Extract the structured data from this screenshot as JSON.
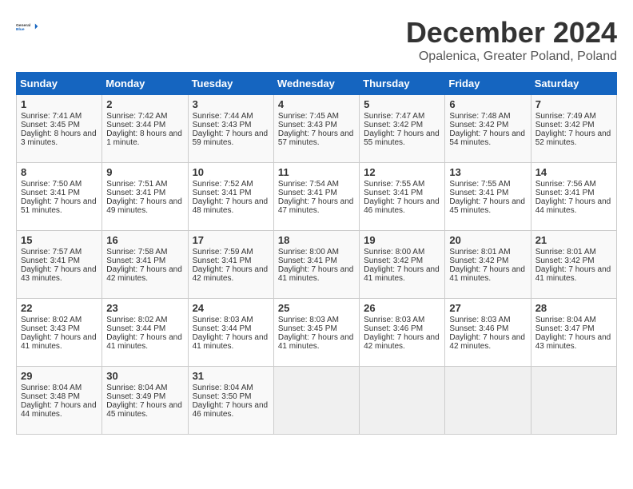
{
  "header": {
    "logo_line1": "General",
    "logo_line2": "Blue",
    "month_title": "December 2024",
    "subtitle": "Opalenica, Greater Poland, Poland"
  },
  "days_of_week": [
    "Sunday",
    "Monday",
    "Tuesday",
    "Wednesday",
    "Thursday",
    "Friday",
    "Saturday"
  ],
  "weeks": [
    [
      {
        "day": "1",
        "sunrise": "Sunrise: 7:41 AM",
        "sunset": "Sunset: 3:45 PM",
        "daylight": "Daylight: 8 hours and 3 minutes."
      },
      {
        "day": "2",
        "sunrise": "Sunrise: 7:42 AM",
        "sunset": "Sunset: 3:44 PM",
        "daylight": "Daylight: 8 hours and 1 minute."
      },
      {
        "day": "3",
        "sunrise": "Sunrise: 7:44 AM",
        "sunset": "Sunset: 3:43 PM",
        "daylight": "Daylight: 7 hours and 59 minutes."
      },
      {
        "day": "4",
        "sunrise": "Sunrise: 7:45 AM",
        "sunset": "Sunset: 3:43 PM",
        "daylight": "Daylight: 7 hours and 57 minutes."
      },
      {
        "day": "5",
        "sunrise": "Sunrise: 7:47 AM",
        "sunset": "Sunset: 3:42 PM",
        "daylight": "Daylight: 7 hours and 55 minutes."
      },
      {
        "day": "6",
        "sunrise": "Sunrise: 7:48 AM",
        "sunset": "Sunset: 3:42 PM",
        "daylight": "Daylight: 7 hours and 54 minutes."
      },
      {
        "day": "7",
        "sunrise": "Sunrise: 7:49 AM",
        "sunset": "Sunset: 3:42 PM",
        "daylight": "Daylight: 7 hours and 52 minutes."
      }
    ],
    [
      {
        "day": "8",
        "sunrise": "Sunrise: 7:50 AM",
        "sunset": "Sunset: 3:41 PM",
        "daylight": "Daylight: 7 hours and 51 minutes."
      },
      {
        "day": "9",
        "sunrise": "Sunrise: 7:51 AM",
        "sunset": "Sunset: 3:41 PM",
        "daylight": "Daylight: 7 hours and 49 minutes."
      },
      {
        "day": "10",
        "sunrise": "Sunrise: 7:52 AM",
        "sunset": "Sunset: 3:41 PM",
        "daylight": "Daylight: 7 hours and 48 minutes."
      },
      {
        "day": "11",
        "sunrise": "Sunrise: 7:54 AM",
        "sunset": "Sunset: 3:41 PM",
        "daylight": "Daylight: 7 hours and 47 minutes."
      },
      {
        "day": "12",
        "sunrise": "Sunrise: 7:55 AM",
        "sunset": "Sunset: 3:41 PM",
        "daylight": "Daylight: 7 hours and 46 minutes."
      },
      {
        "day": "13",
        "sunrise": "Sunrise: 7:55 AM",
        "sunset": "Sunset: 3:41 PM",
        "daylight": "Daylight: 7 hours and 45 minutes."
      },
      {
        "day": "14",
        "sunrise": "Sunrise: 7:56 AM",
        "sunset": "Sunset: 3:41 PM",
        "daylight": "Daylight: 7 hours and 44 minutes."
      }
    ],
    [
      {
        "day": "15",
        "sunrise": "Sunrise: 7:57 AM",
        "sunset": "Sunset: 3:41 PM",
        "daylight": "Daylight: 7 hours and 43 minutes."
      },
      {
        "day": "16",
        "sunrise": "Sunrise: 7:58 AM",
        "sunset": "Sunset: 3:41 PM",
        "daylight": "Daylight: 7 hours and 42 minutes."
      },
      {
        "day": "17",
        "sunrise": "Sunrise: 7:59 AM",
        "sunset": "Sunset: 3:41 PM",
        "daylight": "Daylight: 7 hours and 42 minutes."
      },
      {
        "day": "18",
        "sunrise": "Sunrise: 8:00 AM",
        "sunset": "Sunset: 3:41 PM",
        "daylight": "Daylight: 7 hours and 41 minutes."
      },
      {
        "day": "19",
        "sunrise": "Sunrise: 8:00 AM",
        "sunset": "Sunset: 3:42 PM",
        "daylight": "Daylight: 7 hours and 41 minutes."
      },
      {
        "day": "20",
        "sunrise": "Sunrise: 8:01 AM",
        "sunset": "Sunset: 3:42 PM",
        "daylight": "Daylight: 7 hours and 41 minutes."
      },
      {
        "day": "21",
        "sunrise": "Sunrise: 8:01 AM",
        "sunset": "Sunset: 3:42 PM",
        "daylight": "Daylight: 7 hours and 41 minutes."
      }
    ],
    [
      {
        "day": "22",
        "sunrise": "Sunrise: 8:02 AM",
        "sunset": "Sunset: 3:43 PM",
        "daylight": "Daylight: 7 hours and 41 minutes."
      },
      {
        "day": "23",
        "sunrise": "Sunrise: 8:02 AM",
        "sunset": "Sunset: 3:44 PM",
        "daylight": "Daylight: 7 hours and 41 minutes."
      },
      {
        "day": "24",
        "sunrise": "Sunrise: 8:03 AM",
        "sunset": "Sunset: 3:44 PM",
        "daylight": "Daylight: 7 hours and 41 minutes."
      },
      {
        "day": "25",
        "sunrise": "Sunrise: 8:03 AM",
        "sunset": "Sunset: 3:45 PM",
        "daylight": "Daylight: 7 hours and 41 minutes."
      },
      {
        "day": "26",
        "sunrise": "Sunrise: 8:03 AM",
        "sunset": "Sunset: 3:46 PM",
        "daylight": "Daylight: 7 hours and 42 minutes."
      },
      {
        "day": "27",
        "sunrise": "Sunrise: 8:03 AM",
        "sunset": "Sunset: 3:46 PM",
        "daylight": "Daylight: 7 hours and 42 minutes."
      },
      {
        "day": "28",
        "sunrise": "Sunrise: 8:04 AM",
        "sunset": "Sunset: 3:47 PM",
        "daylight": "Daylight: 7 hours and 43 minutes."
      }
    ],
    [
      {
        "day": "29",
        "sunrise": "Sunrise: 8:04 AM",
        "sunset": "Sunset: 3:48 PM",
        "daylight": "Daylight: 7 hours and 44 minutes."
      },
      {
        "day": "30",
        "sunrise": "Sunrise: 8:04 AM",
        "sunset": "Sunset: 3:49 PM",
        "daylight": "Daylight: 7 hours and 45 minutes."
      },
      {
        "day": "31",
        "sunrise": "Sunrise: 8:04 AM",
        "sunset": "Sunset: 3:50 PM",
        "daylight": "Daylight: 7 hours and 46 minutes."
      },
      null,
      null,
      null,
      null
    ]
  ]
}
